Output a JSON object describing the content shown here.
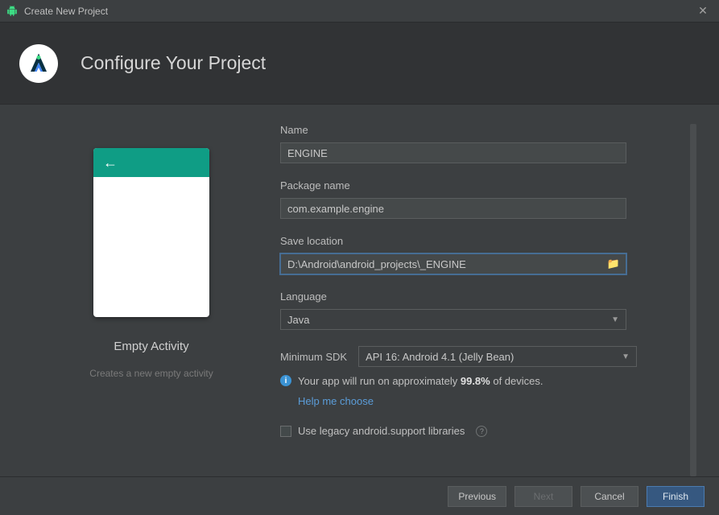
{
  "window": {
    "title": "Create New Project",
    "close_glyph": "✕"
  },
  "header": {
    "title": "Configure Your Project"
  },
  "template": {
    "name": "Empty Activity",
    "description": "Creates a new empty activity",
    "back_arrow": "←"
  },
  "form": {
    "name_label": "Name",
    "name_value": "ENGINE",
    "package_label": "Package name",
    "package_value": "com.example.engine",
    "location_label": "Save location",
    "location_value": "D:\\Android\\android_projects\\_ENGINE",
    "language_label": "Language",
    "language_value": "Java",
    "sdk_label": "Minimum SDK",
    "sdk_value": "API 16: Android 4.1 (Jelly Bean)",
    "info_prefix": "Your app will run on approximately ",
    "info_percent": "99.8%",
    "info_suffix": " of devices.",
    "help_link": "Help me choose",
    "legacy_label": "Use legacy android.support libraries",
    "folder_glyph": "📁",
    "caret_glyph": "▼",
    "info_glyph": "i",
    "help_glyph": "?"
  },
  "footer": {
    "previous": "Previous",
    "next": "Next",
    "cancel": "Cancel",
    "finish": "Finish"
  }
}
